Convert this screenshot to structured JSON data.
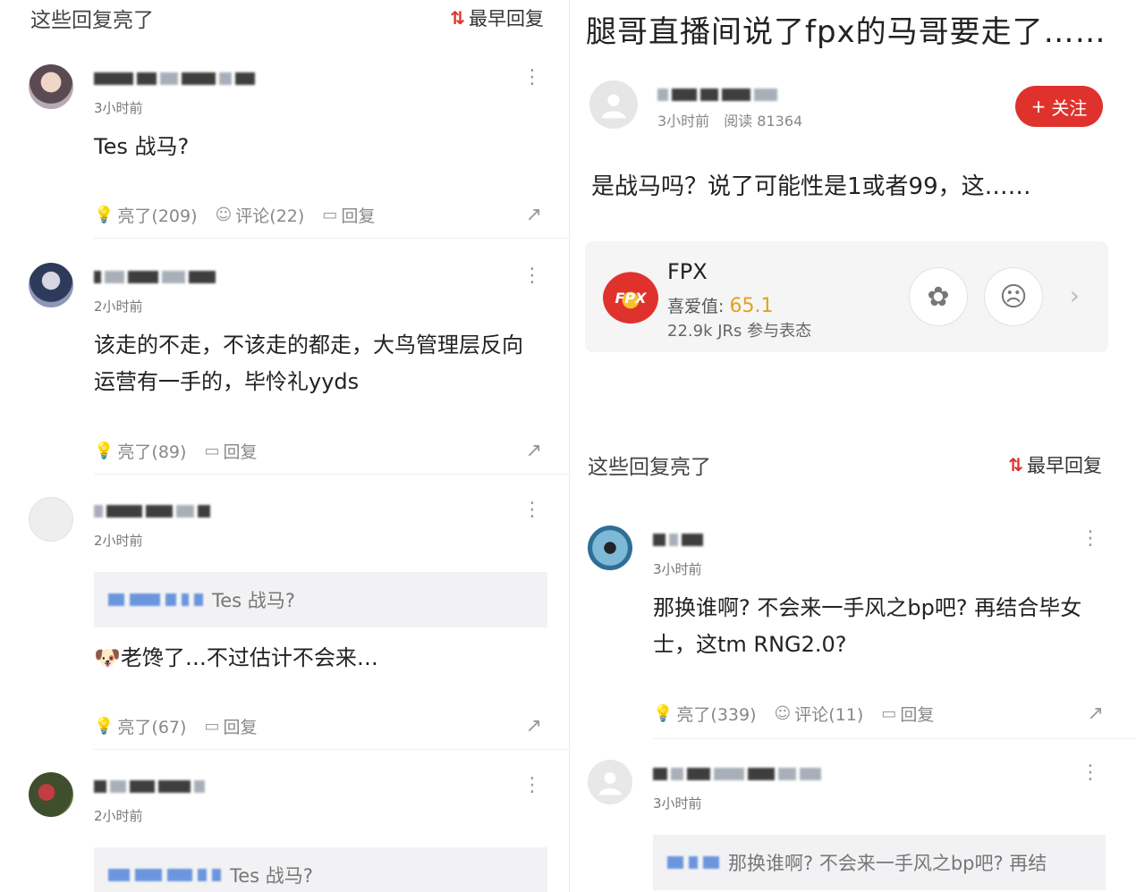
{
  "left": {
    "section_title": "这些回复亮了",
    "sort_label": "最早回复",
    "comments": [
      {
        "time": "3小时前",
        "text": "Tes 战马?",
        "like_label": "亮了(209)",
        "comment_label": "评论(22)",
        "reply_label": "回复"
      },
      {
        "time": "2小时前",
        "text_lines": [
          "该走的不走，不该走的都走，大鸟管理层反向",
          "运营有一手的，毕怜礼yyds"
        ],
        "like_label": "亮了(89)",
        "reply_label": "回复"
      },
      {
        "time": "2小时前",
        "quote": "Tes 战马?",
        "text": "老馋了…不过估计不会来…",
        "emoji": "🐶",
        "like_label": "亮了(67)",
        "reply_label": "回复"
      },
      {
        "time": "2小时前",
        "quote": "Tes 战马?"
      }
    ]
  },
  "right": {
    "post_title": "腿哥直播间说了fpx的马哥要走了……",
    "post_time": "3小时前",
    "read_count": "阅读 81364",
    "follow_label": "关注",
    "post_body": "是战马吗？说了可能性是1或者99，这……",
    "team": {
      "name": "FPX",
      "logo_text": "FPX",
      "fav_label": "喜爱值:",
      "fav_value": "65.1",
      "participants": "22.9k JRs 参与表态"
    },
    "section_title": "这些回复亮了",
    "sort_label": "最早回复",
    "comments": [
      {
        "time": "3小时前",
        "text_lines": [
          "那换谁啊? 不会来一手风之bp吧? 再结合毕女",
          "士，这tm RNG2.0?"
        ],
        "like_label": "亮了(339)",
        "comment_label": "评论(11)",
        "reply_label": "回复"
      },
      {
        "time": "3小时前",
        "quote": "那换谁啊? 不会来一手风之bp吧? 再结"
      }
    ]
  },
  "colors": {
    "accent": "#e0322d",
    "fav": "#e3a21a",
    "link_blur": "#4a7fd8"
  }
}
